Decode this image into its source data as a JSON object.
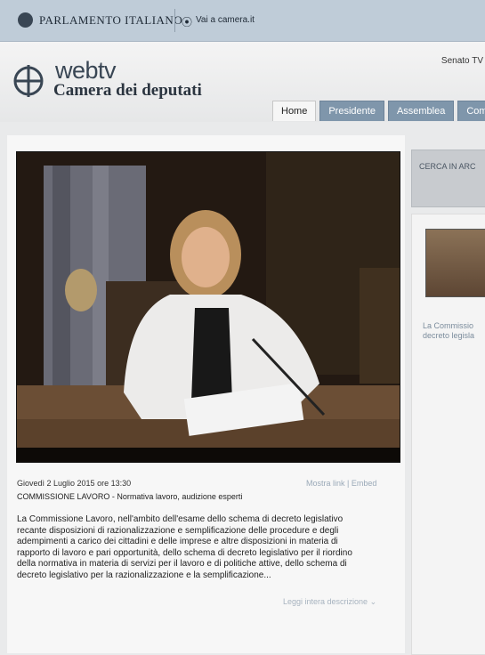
{
  "topbar": {
    "brand": "PARLAMENTO ITALIANO",
    "vai_label": "Vai a camera.it"
  },
  "header": {
    "logo_text": "webtv",
    "logo_subtitle": "Camera dei deputati",
    "senato_link": "Senato TV"
  },
  "tabs": [
    {
      "label": "Home",
      "active": true
    },
    {
      "label": "Presidente",
      "active": false
    },
    {
      "label": "Assemblea",
      "active": false
    },
    {
      "label": "Com",
      "active": false
    }
  ],
  "video": {
    "date": "Giovedì 2 Luglio 2015 ore 13:30",
    "title": "COMMISSIONE LAVORO - Normativa lavoro, audizione esperti",
    "link_show": "Mostra link",
    "link_sep": "|",
    "link_embed": "Embed",
    "description": [
      "La Commissione Lavoro, nell'ambito dell'esame dello schema di decreto legislativo",
      "recante disposizioni di razionalizzazione e semplificazione delle procedure e degli",
      "adempimenti a carico dei cittadini e delle imprese e altre disposizioni in materia di",
      "rapporto di lavoro e pari opportunità, dello schema di decreto legislativo per il riordino",
      "della normativa in materia di servizi per il lavoro e di politiche attive, dello schema di",
      "decreto legislativo per la razionalizzazione e la semplificazione..."
    ],
    "read_more": "Leggi intera descrizione"
  },
  "sidebar": {
    "search_label": "CERCA IN ARC",
    "caption_line1": "La Commissio",
    "caption_line2": "decreto legisla"
  }
}
